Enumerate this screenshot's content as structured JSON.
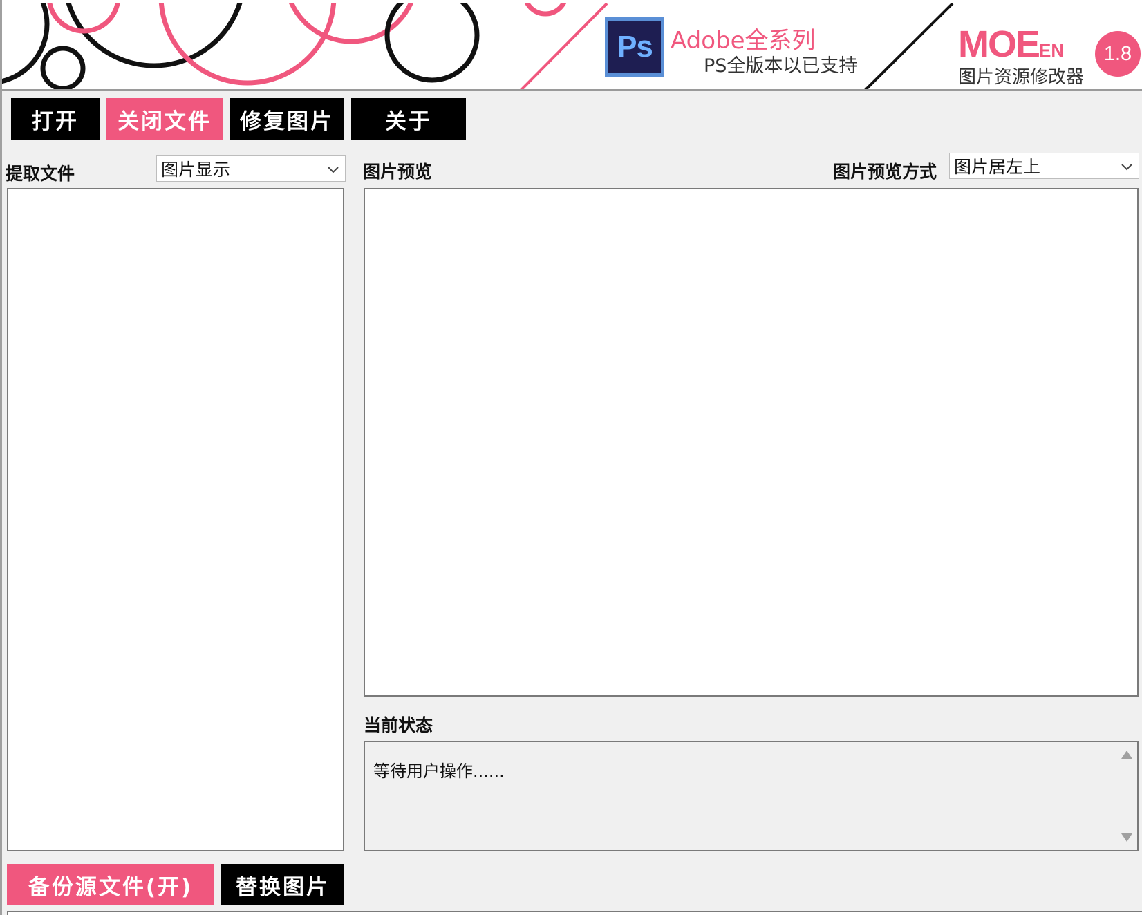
{
  "banner": {
    "ad_title": "Adobe全系列",
    "ad_subtitle": "PS全版本以已支持",
    "ps_logo_text": "Ps",
    "brand_main": "MOE",
    "brand_suffix": "EN",
    "brand_subtitle": "图片资源修改器",
    "version": "1.8",
    "colors": {
      "accent": "#f0577e",
      "dark": "#000000"
    }
  },
  "toolbar": {
    "open_label": "打开",
    "close_file_label": "关闭文件",
    "repair_image_label": "修复图片",
    "about_label": "关于"
  },
  "left": {
    "extract_label": "提取文件",
    "display_mode_selected": "图片显示"
  },
  "preview": {
    "title": "图片预览",
    "mode_label": "图片预览方式",
    "mode_selected": "图片居左上"
  },
  "status": {
    "title": "当前状态",
    "text": "等待用户操作......"
  },
  "bottom": {
    "backup_label": "备份源文件(开)",
    "replace_label": "替换图片"
  },
  "icons": {
    "dropdown": "chevron-down-icon",
    "scroll_up": "scroll-up-arrow-icon",
    "scroll_down": "scroll-down-arrow-icon"
  }
}
